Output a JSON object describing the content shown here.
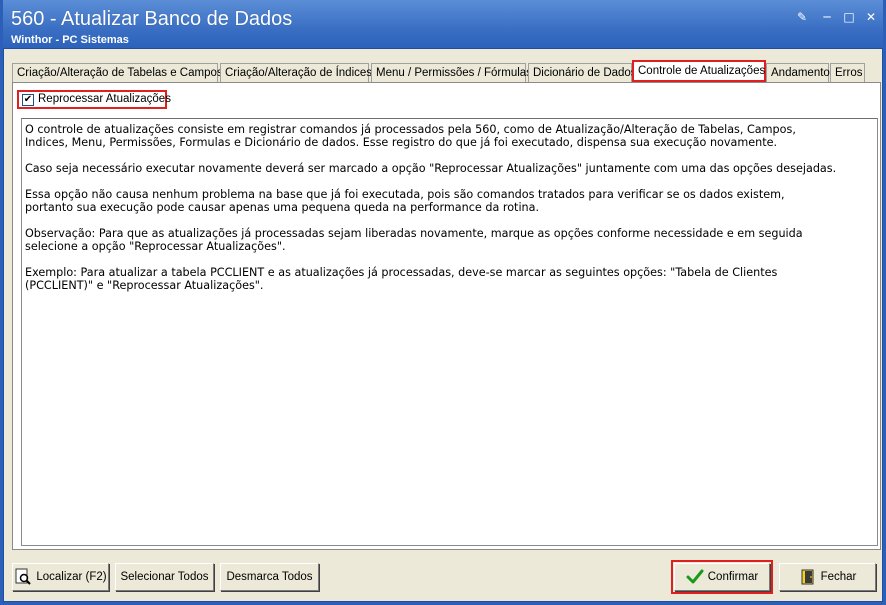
{
  "window": {
    "title": "560 - Atualizar Banco de Dados",
    "subtitle": "Winthor - PC Sistemas"
  },
  "tabs": [
    {
      "label": "Criação/Alteração de Tabelas e Campos"
    },
    {
      "label": "Criação/Alteração de Índices"
    },
    {
      "label": "Menu / Permissões / Fórmulas"
    },
    {
      "label": "Dicionário de Dados"
    },
    {
      "label": "Controle de Atualizações",
      "active": true
    },
    {
      "label": "Andamento"
    },
    {
      "label": "Erros"
    }
  ],
  "checkbox": {
    "label": "Reprocessar Atualizações",
    "checked": true
  },
  "memo": {
    "paragraphs": [
      "O controle de atualizações consiste em registrar comandos já processados pela 560, como de Atualização/Alteração de Tabelas, Campos,\nIndices, Menu, Permissões, Formulas e Dicionário de dados. Esse registro do que já foi executado, dispensa sua execução novamente.",
      "Caso seja necessário executar novamente deverá ser marcado a opção \"Reprocessar Atualizações\" juntamente com uma das opções desejadas.",
      "Essa opção não causa nenhum problema na base que já foi executada, pois são comandos tratados para verificar se os dados existem,\nportanto sua execução pode causar apenas uma pequena queda na performance da rotina.",
      "Observação: Para que as atualizações já processadas sejam liberadas novamente, marque as opções conforme necessidade e em seguida\nselecione a opção \"Reprocessar Atualizações\".",
      "Exemplo: Para atualizar a tabela PCCLIENT e as atualizações já processadas, deve-se marcar as seguintes opções: \"Tabela de Clientes\n(PCCLIENT)\" e \"Reprocessar Atualizações\"."
    ]
  },
  "buttons": {
    "localizar": "Localizar (F2)",
    "selecionar_todos": "Selecionar Todos",
    "desmarca_todos": "Desmarca Todos",
    "confirmar": "Confirmar",
    "fechar": "Fechar"
  },
  "colors": {
    "titlebar": "#3a6fc4",
    "highlight": "#e01f1f",
    "confirm_check": "#1a9a1a"
  }
}
